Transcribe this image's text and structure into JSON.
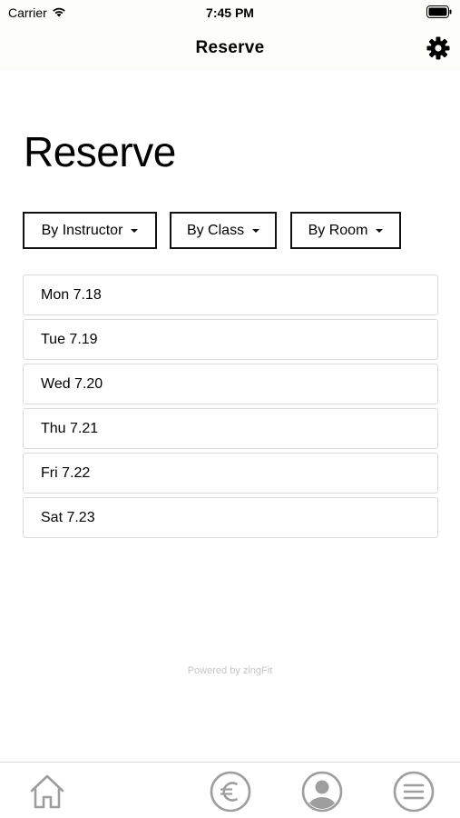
{
  "status_bar": {
    "carrier": "Carrier",
    "time": "7:45 PM"
  },
  "nav": {
    "title": "Reserve",
    "settings_icon": "gear-icon"
  },
  "page": {
    "heading": "Reserve"
  },
  "filters": [
    {
      "label": "By Instructor",
      "icon": "caret-down-icon"
    },
    {
      "label": "By Class",
      "icon": "caret-down-icon"
    },
    {
      "label": "By Room",
      "icon": "caret-down-icon"
    }
  ],
  "days": [
    {
      "label": "Mon 7.18"
    },
    {
      "label": "Tue 7.19"
    },
    {
      "label": "Wed 7.20"
    },
    {
      "label": "Thu 7.21"
    },
    {
      "label": "Fri 7.22"
    },
    {
      "label": "Sat 7.23"
    }
  ],
  "footer": {
    "powered_by": "Powered by zingFit"
  },
  "tab_bar": {
    "items": [
      {
        "icon": "home-icon"
      },
      {
        "icon": "euro-icon"
      },
      {
        "icon": "profile-icon"
      },
      {
        "icon": "menu-icon"
      }
    ]
  },
  "colors": {
    "bar_background": "#fdfdfa",
    "border": "#111111",
    "list_border": "#dcdcdc",
    "tab_icon": "#9e9e9e",
    "powered_text": "#c6c6c6"
  }
}
